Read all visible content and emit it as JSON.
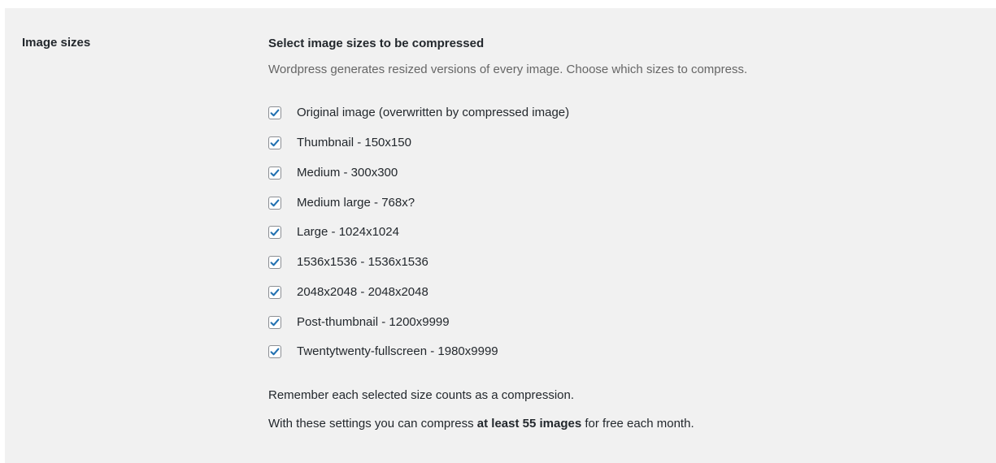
{
  "settings_row": {
    "label": "Image sizes"
  },
  "section": {
    "heading": "Select image sizes to be compressed",
    "description": "Wordpress generates resized versions of every image. Choose which sizes to compress."
  },
  "image_sizes": [
    {
      "label": "Original image (overwritten by compressed image)",
      "checked": true
    },
    {
      "label": "Thumbnail - 150x150",
      "checked": true
    },
    {
      "label": "Medium - 300x300",
      "checked": true
    },
    {
      "label": "Medium large - 768x?",
      "checked": true
    },
    {
      "label": "Large - 1024x1024",
      "checked": true
    },
    {
      "label": "1536x1536 - 1536x1536",
      "checked": true
    },
    {
      "label": "2048x2048 - 2048x2048",
      "checked": true
    },
    {
      "label": "Post-thumbnail - 1200x9999",
      "checked": true
    },
    {
      "label": "Twentytwenty-fullscreen - 1980x9999",
      "checked": true
    }
  ],
  "notes": {
    "remember": "Remember each selected size counts as a compression.",
    "summary_prefix": "With these settings you can compress ",
    "summary_bold": "at least 55 images",
    "summary_suffix": " for free each month."
  },
  "colors": {
    "panel_background": "#f1f1f1",
    "checkmark": "#2271b1",
    "text": "#23282d",
    "muted_text": "#666666"
  },
  "icons": {
    "checkbox_checked": "checkmark-icon"
  }
}
